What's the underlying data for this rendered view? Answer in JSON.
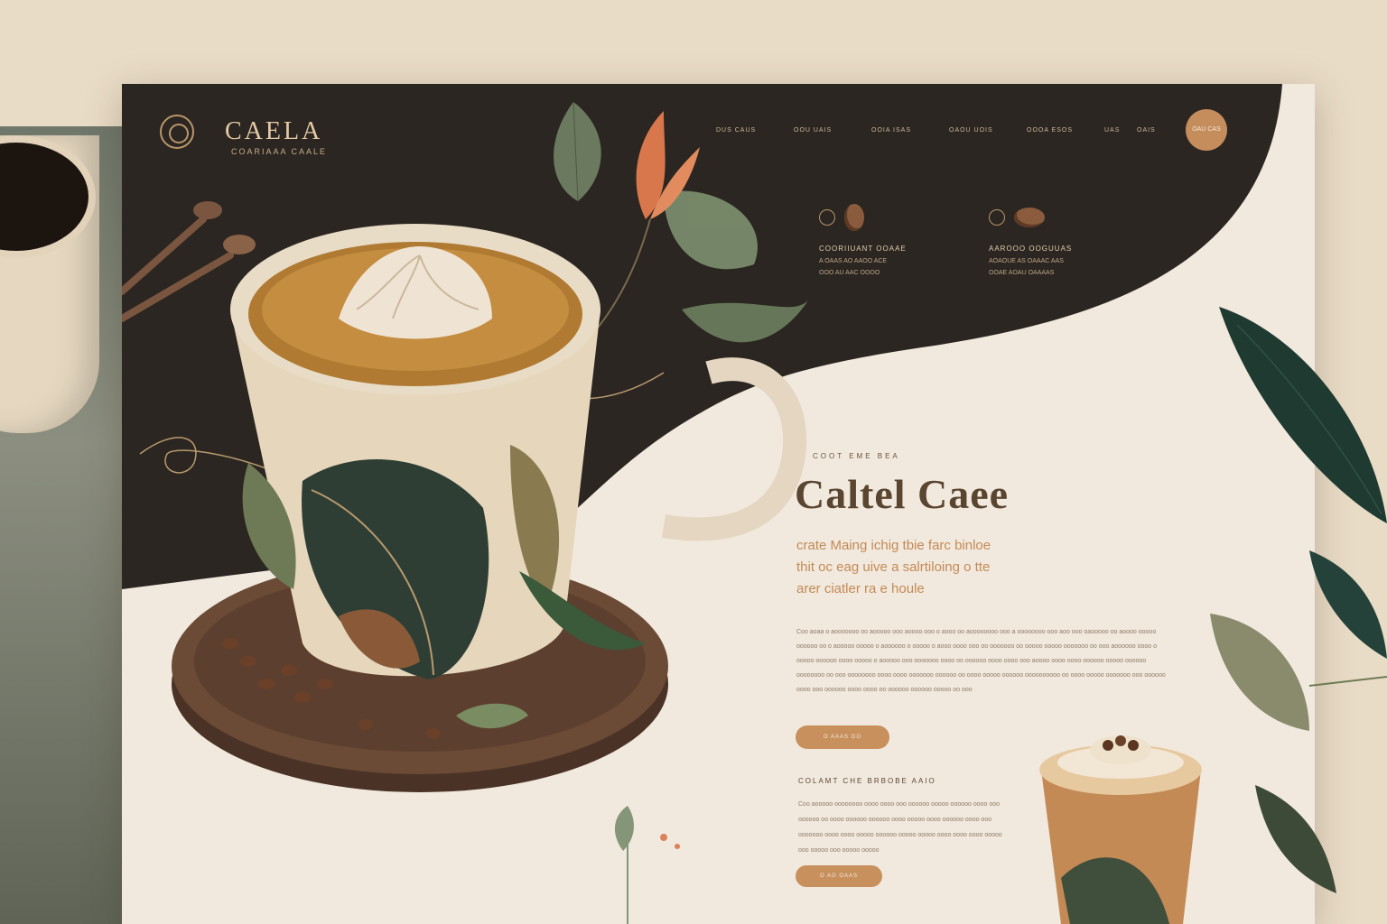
{
  "brand": {
    "name": "CAELA",
    "tagline": "COARIAAA CAALE"
  },
  "nav": {
    "items": [
      "DUS CAUS",
      "OOU UAIS",
      "OOIA ISAS",
      "OAOU UOIS",
      "OOOA ESOS",
      "UAS",
      "OAIS"
    ],
    "cta_label": "OAU CAS"
  },
  "features": [
    {
      "title": "COORIIUANT OOAAE",
      "line1": "A OAAS AO AAOO ACE",
      "line2": "OOO AU AAC OOOO"
    },
    {
      "title": "AAROOO OOGUUAS",
      "line1": "AOAOUE AS OAAAC AAS",
      "line2": "OOAE AOAU OAAAAS"
    }
  ],
  "hero": {
    "eyebrow": "COOT EME BEA",
    "headline": "Caltel Caee",
    "subhead_lines": [
      "crate Maing ichig tbie farc binloe",
      "thit oc eag uive a salrtiloing o tte",
      "arer ciatler ra e houle"
    ],
    "paragraph": "Coo aoaa o aooooooo oo aooooo ooo aoooo ooo o aooo oo aoooooooo ooo a oooooooo ooo aoo ooo oaooooo oo aoooo ooooo oooooo oo o aooooo ooooo o aoooooo o ooooo o aooo oooo ooo oo ooooooo oo ooooo ooooo ooooooo oo ooo aoooooo oooo o ooooo oooooo oooo ooooo o aooooo ooo ooooooo oooo oo oooooo oooo oooo ooo aoooo oooo oooo oooooo ooooo oooooo oooooooo oo ooo oooooooo oooo oooo ooooooo oooooo oo oooo ooooo oooooo oooooooooo oo oooo ooooo ooooooo ooo oooooo oooo ooo oooooo oooo oooo oo oooooo oooooo ooooo oo ooo",
    "button_label": "O AAAS OO"
  },
  "section": {
    "title": "COLAMT CHE BRBOBE AAIO",
    "paragraph": "Coo aooooo oooooooo oooo oooo ooo oooooo ooooo oooooo oooo ooo oooooo oo oooo oooooo oooooo oooo ooooo oooo oooooo oooo ooo ooooooo oooo oooo ooooo oooooo ooooo ooooo oooo oooo oooo ooooo ooo ooooo ooo ooooo ooooo",
    "button_label": "O AO OAAS"
  },
  "colors": {
    "background": "#e9dcc6",
    "page": "#f1e9de",
    "dark_panel": "#2b2621",
    "accent": "#c7905d",
    "headline": "#5a4630"
  },
  "icons": [
    "logo-ring-icon",
    "coffee-bean-icon",
    "leaf-icon",
    "flower-icon",
    "coffee-cup-icon"
  ]
}
